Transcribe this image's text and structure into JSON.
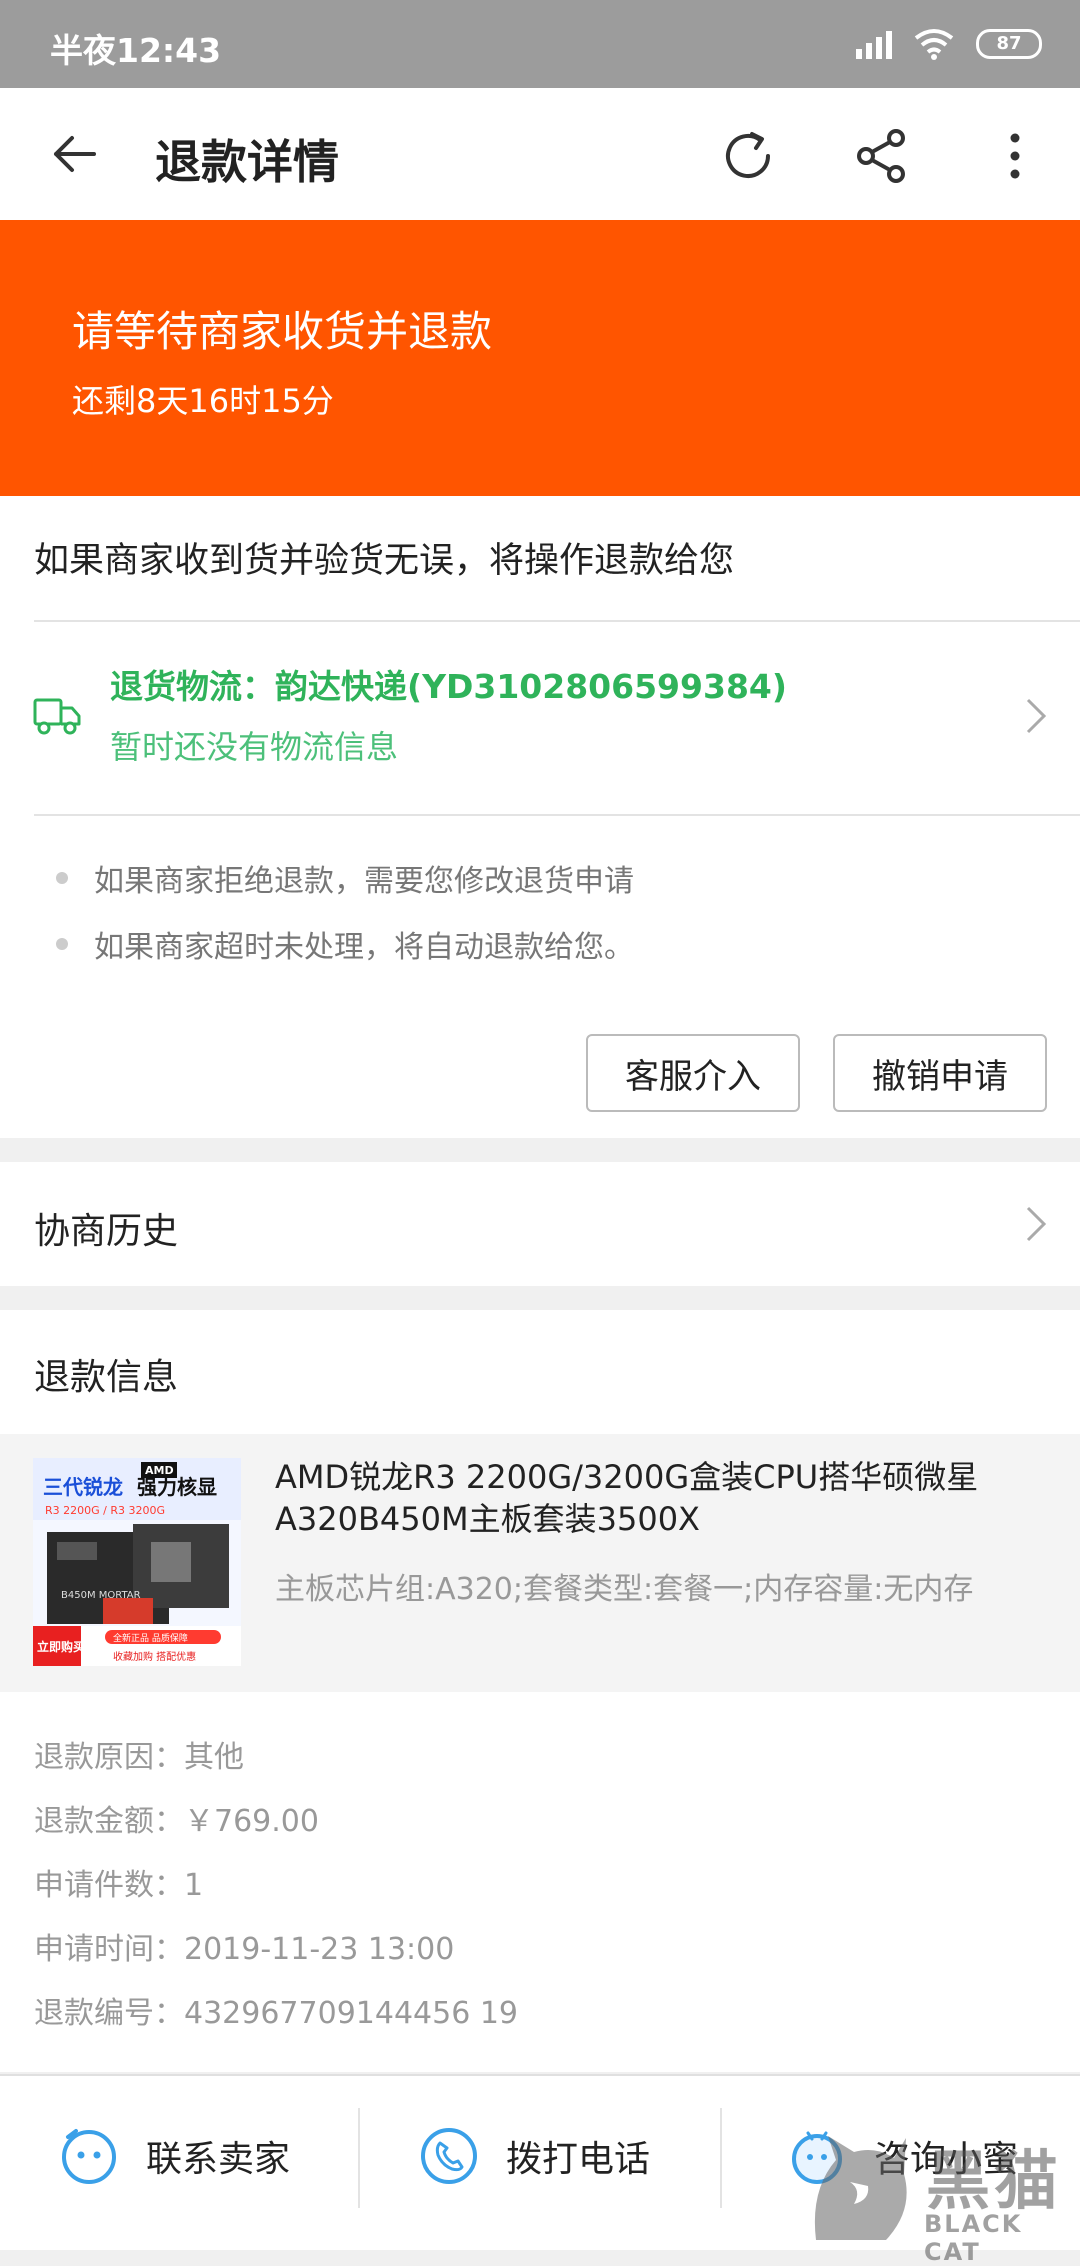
{
  "status_bar": {
    "time": "半夜12:43",
    "battery": "87"
  },
  "app_bar": {
    "title": "退款详情"
  },
  "banner": {
    "title": "请等待商家收货并退款",
    "countdown": "还剩8天16时15分"
  },
  "refund_notice": "如果商家收到货并验货无误，将操作退款给您",
  "logistics": {
    "title": "退货物流：韵达快递(YD3102806599384)",
    "status": "暂时还没有物流信息"
  },
  "tips": [
    "如果商家拒绝退款，需要您修改退货申请",
    "如果商家超时未处理，将自动退款给您。"
  ],
  "actions": {
    "service": "客服介入",
    "cancel": "撤销申请"
  },
  "history": {
    "label": "协商历史"
  },
  "refund_info": {
    "title": "退款信息",
    "product": {
      "name": "AMD锐龙R3 2200G/3200G盒装CPU搭华硕微星A320B450M主板套装3500X",
      "spec": "主板芯片组:A320;套餐类型:套餐一;内存容量:无内存",
      "thumb": {
        "headline": "三代锐龙",
        "slogan": "强力核显",
        "model": "R3 2200G / R3 3200G",
        "brand": "AMD",
        "board": "B450M MORTAR",
        "cta": "立即购买",
        "badge1": "全新正品 品质保障",
        "badge2": "收藏加购 搭配优惠"
      }
    },
    "rows": [
      {
        "label": "退款原因：",
        "value": "其他"
      },
      {
        "label": "退款金额：",
        "value": "￥769.00"
      },
      {
        "label": "申请件数：",
        "value": "1"
      },
      {
        "label": "申请时间：",
        "value": "2019-11-23 13:00"
      },
      {
        "label": "退款编号：",
        "value": "432967709144456 19"
      }
    ]
  },
  "bottom_bar": {
    "contact": "联系卖家",
    "call": "拨打电话",
    "consult": "咨询小蜜"
  },
  "watermark": {
    "text": "黑猫",
    "sub": "BLACK CAT"
  },
  "colors": {
    "accent": "#ff5500",
    "logistics": "#2fb35a"
  }
}
